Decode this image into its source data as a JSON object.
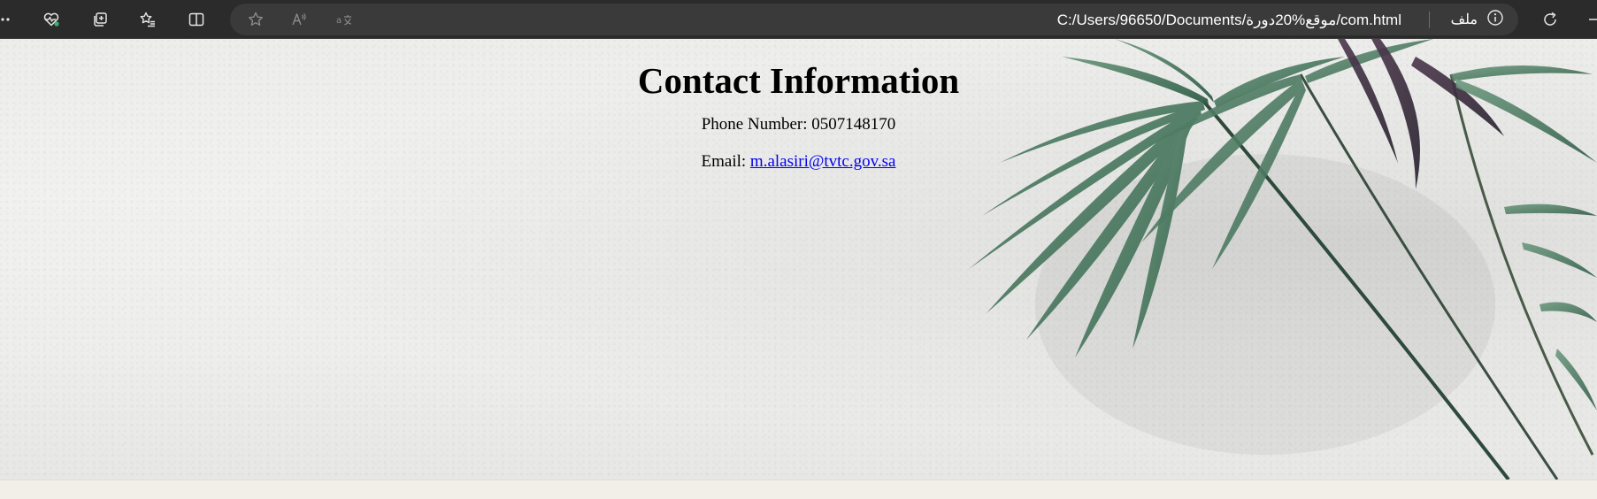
{
  "browser": {
    "url": "C:/Users/96650/Documents/موقع%20دورة/com.html",
    "site_info_label": "ملف",
    "icons": {
      "menu": "more-dots-icon",
      "health": "browser-essentials-heart-icon",
      "collections": "collections-icon",
      "favorites": "favorites-list-icon",
      "split": "split-screen-icon",
      "favorite_star": "add-favorite-star-icon",
      "read_aloud": "read-aloud-icon",
      "translate": "translate-icon",
      "info": "info-circle-icon",
      "refresh": "refresh-icon",
      "minimize": "minimize-icon"
    },
    "accent_colors": {
      "toolbar_bg": "#2b2b2b",
      "addressbar_bg": "#3a3a3a",
      "health_badge": "#3cb371"
    }
  },
  "page": {
    "title": "Contact Information",
    "phone_label": "Phone Number:",
    "phone_value": "0507148170",
    "email_label": "Email:",
    "email_value": "m.alasiri@tvtc.gov.sa",
    "link_color": "#0000ee",
    "background": "white textured wall with a palm plant on the right"
  }
}
